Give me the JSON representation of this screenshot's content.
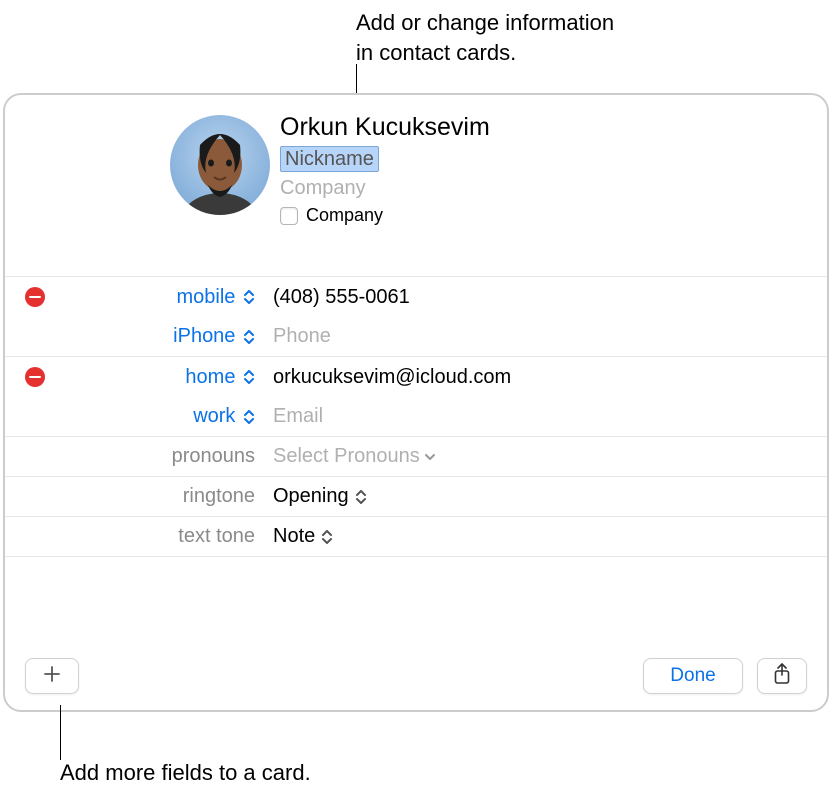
{
  "callouts": {
    "top_line1": "Add or change information",
    "top_line2": "in contact cards.",
    "bottom": "Add more fields to a card."
  },
  "contact": {
    "name": "Orkun Kucuksevim",
    "nickname_placeholder": "Nickname",
    "company_placeholder": "Company",
    "company_checkbox_label": "Company"
  },
  "fields": {
    "phone1": {
      "label": "mobile",
      "value": "(408) 555-0061"
    },
    "phone2": {
      "label": "iPhone",
      "placeholder": "Phone"
    },
    "email1": {
      "label": "home",
      "value": "orkucuksevim@icloud.com"
    },
    "email2": {
      "label": "work",
      "placeholder": "Email"
    },
    "pronouns": {
      "label": "pronouns",
      "placeholder": "Select Pronouns"
    },
    "ringtone": {
      "label": "ringtone",
      "value": "Opening"
    },
    "texttone": {
      "label": "text tone",
      "value": "Note"
    }
  },
  "footer": {
    "done": "Done"
  },
  "colors": {
    "accent": "#0b72e8",
    "danger": "#e53030"
  }
}
